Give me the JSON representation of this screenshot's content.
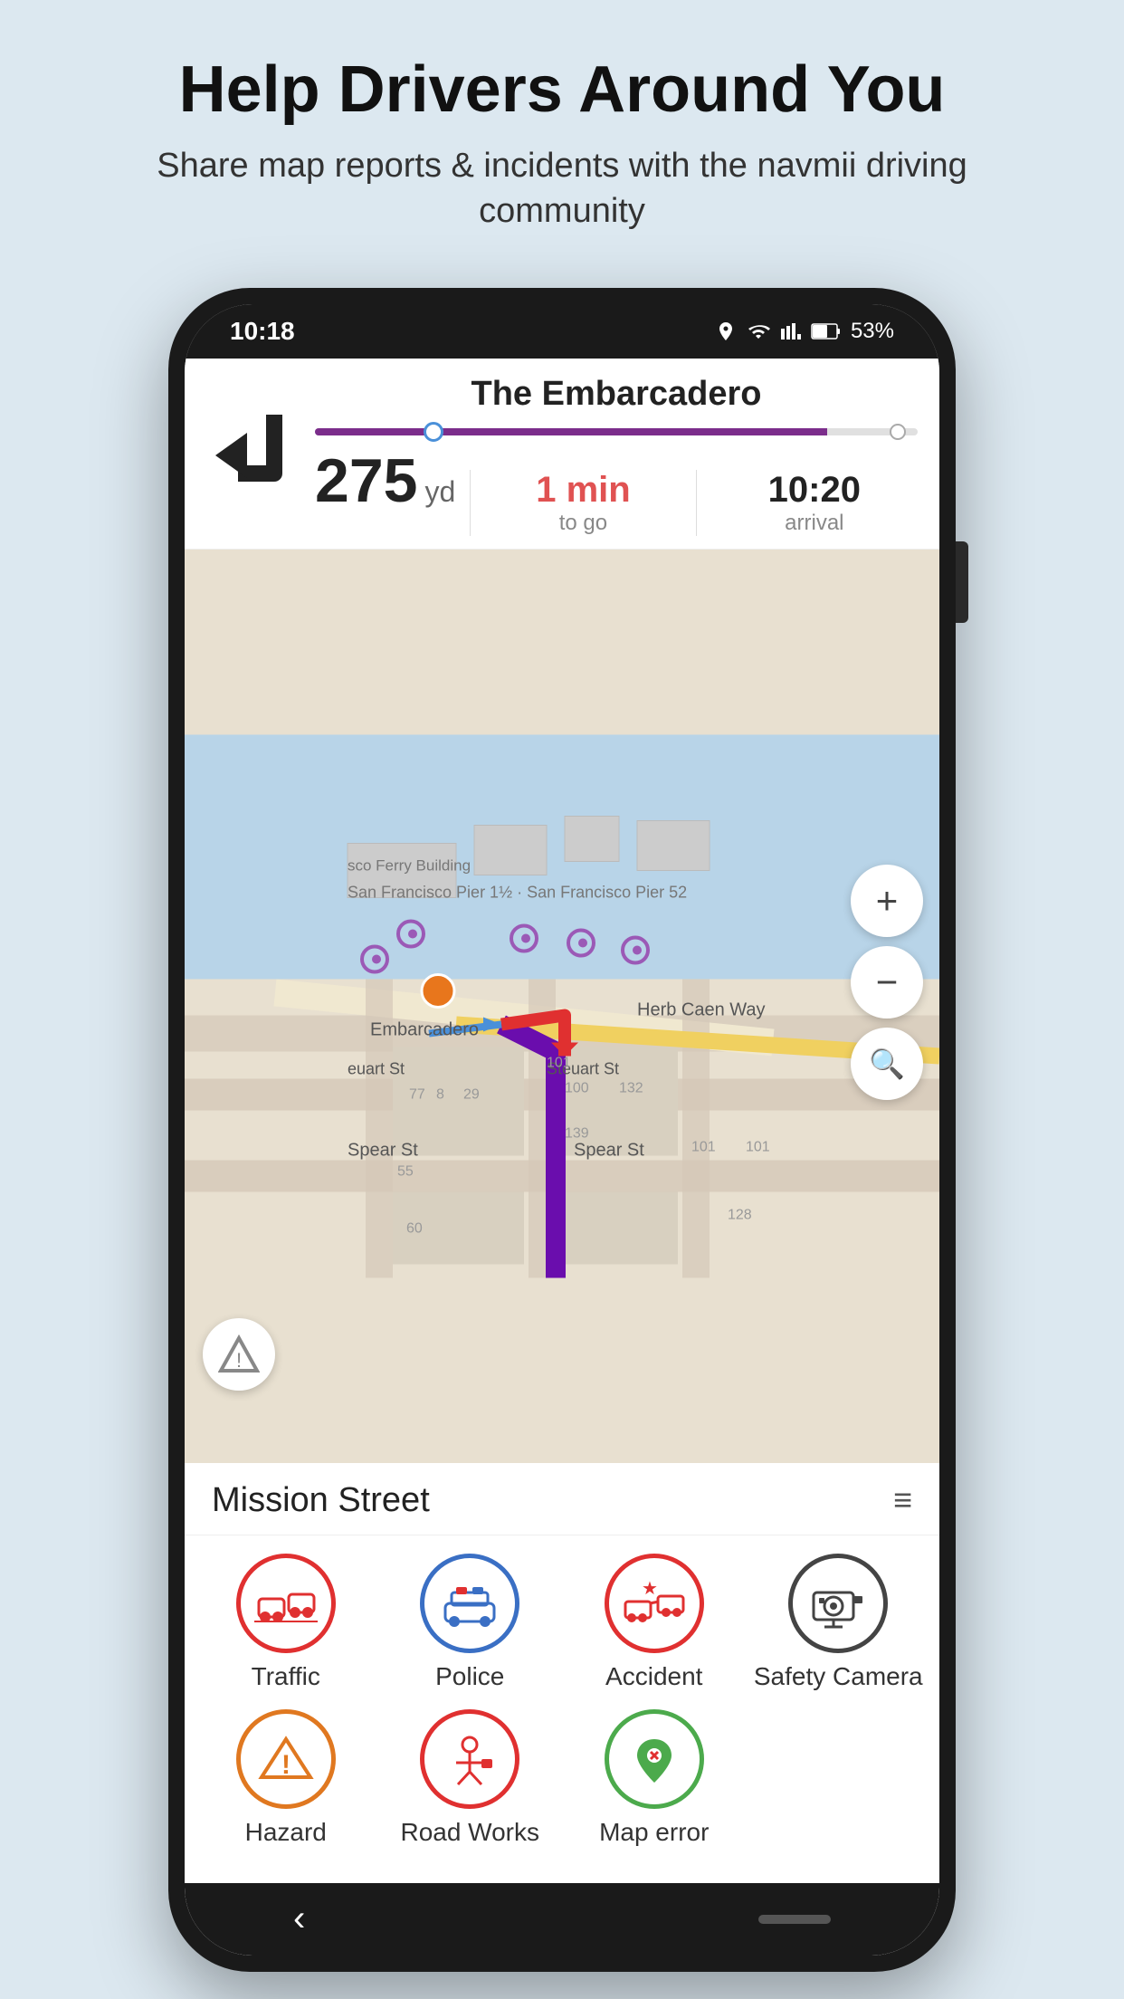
{
  "page": {
    "title": "Help Drivers Around You",
    "subtitle": "Share map reports & incidents with the navmii driving community"
  },
  "status_bar": {
    "time": "10:18",
    "battery": "53%"
  },
  "navigation": {
    "street": "The Embarcadero",
    "distance": "275",
    "distance_unit": "yd",
    "time_value": "1 min",
    "time_label": "to go",
    "arrival_value": "10:20",
    "arrival_label": "arrival"
  },
  "map": {
    "street1": "Embarcadero",
    "street2": "Steuart St",
    "street3": "Spear St",
    "street4": "Herb Caen Way",
    "label1": "San Francisco Pier 1½ · San Francisco Pier 52",
    "label2": "sco Ferry Building"
  },
  "bottom_panel": {
    "street_name": "Mission Street",
    "hamburger_label": "menu"
  },
  "report_items": [
    {
      "id": "traffic",
      "label": "Traffic",
      "border_color": "#e03030",
      "icon_color": "#e03030"
    },
    {
      "id": "police",
      "label": "Police",
      "border_color": "#3a6fc4",
      "icon_color": "#3a6fc4"
    },
    {
      "id": "accident",
      "label": "Accident",
      "border_color": "#e03030",
      "icon_color": "#e03030"
    },
    {
      "id": "safety-camera",
      "label": "Safety Camera",
      "border_color": "#444",
      "icon_color": "#444"
    },
    {
      "id": "hazard",
      "label": "Hazard",
      "border_color": "#e07820",
      "icon_color": "#e07820"
    },
    {
      "id": "road-works",
      "label": "Road Works",
      "border_color": "#e03030",
      "icon_color": "#e03030"
    },
    {
      "id": "map-error",
      "label": "Map error",
      "border_color": "#4caa4c",
      "icon_color": "#4caa4c"
    }
  ],
  "zoom_controls": {
    "plus": "+",
    "minus": "−",
    "search": "🔍"
  }
}
